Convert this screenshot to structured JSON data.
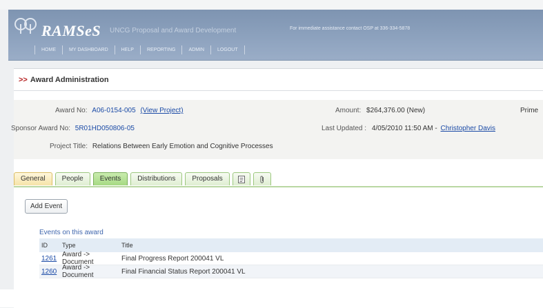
{
  "app": {
    "name": "RAMSeS",
    "subtitle": "UNCG Proposal and Award Development",
    "contact": "For immediate assistance contact OSP at 336-334-5878",
    "brand_color": "#8ba0bd"
  },
  "nav": [
    "HOME",
    "MY DASHBOARD",
    "HELP",
    "REPORTING",
    "ADMIN",
    "LOGOUT"
  ],
  "section": {
    "arrows": ">>",
    "title": "Award Administration"
  },
  "award": {
    "award_no_label": "Award No:",
    "award_no": "A06-0154-005",
    "view_project": "(View Project)",
    "amount_label": "Amount:",
    "amount": "$264,376.00 (New)",
    "prime_label": "Prime",
    "sponsor_label": "Sponsor Award No:",
    "sponsor_no": "5R01HD050806-05",
    "updated_label": "Last Updated :",
    "updated": "4/05/2010 11:50 AM -",
    "updated_by": "Christopher Davis",
    "project_title_label": "Project Title:",
    "project_title": "Relations Between Early Emotion and Cognitive Processes"
  },
  "tabs": [
    {
      "label": "General",
      "icon": ""
    },
    {
      "label": "People",
      "icon": ""
    },
    {
      "label": "Events",
      "icon": ""
    },
    {
      "label": "Distributions",
      "icon": ""
    },
    {
      "label": "Proposals",
      "icon": ""
    },
    {
      "label": "",
      "icon": "document-icon"
    },
    {
      "label": "",
      "icon": "paperclip-icon"
    }
  ],
  "add_event_button": "Add Event",
  "events": {
    "heading": "Events on this award",
    "columns": [
      "ID",
      "Type",
      "Title"
    ],
    "rows": [
      {
        "id": "1261",
        "type": "Award -> Document",
        "title": "Final Progress Report 200041 VL"
      },
      {
        "id": "1260",
        "type": "Award -> Document",
        "title": "Final Financial Status Report 200041 VL"
      }
    ]
  }
}
